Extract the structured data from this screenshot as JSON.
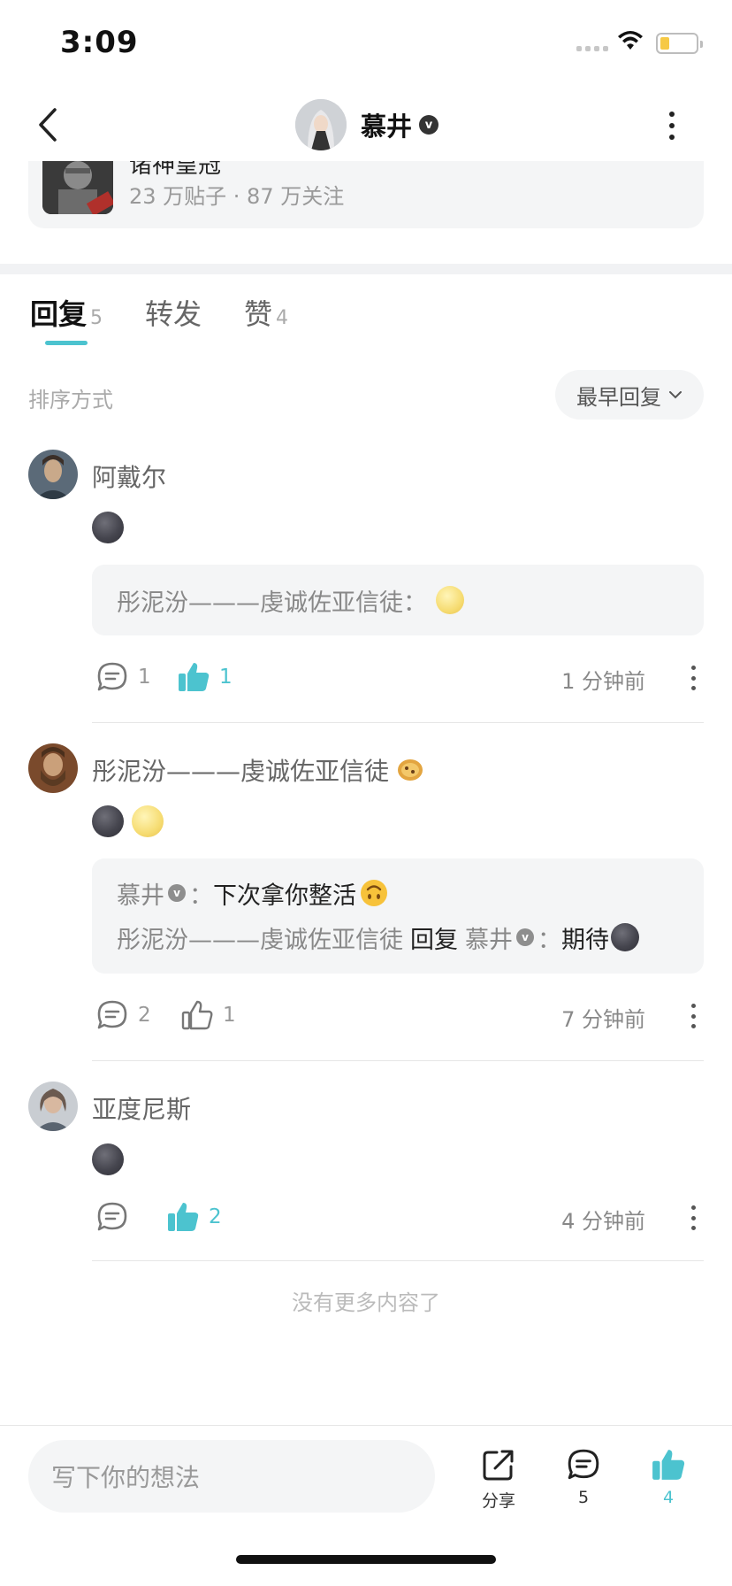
{
  "status_bar": {
    "time": "3:09"
  },
  "nav": {
    "title": "慕井",
    "verified_mark": "v"
  },
  "forum": {
    "name": "诸神皇冠",
    "stats": "23 万贴子 · 87 万关注"
  },
  "tabs": [
    {
      "label": "回复",
      "count": "5",
      "active": true
    },
    {
      "label": "转发",
      "count": "",
      "active": false
    },
    {
      "label": "赞",
      "count": "4",
      "active": false
    }
  ],
  "sort": {
    "label": "排序方式",
    "button": "最早回复"
  },
  "comments": [
    {
      "author": "阿戴尔",
      "body_emojis": [
        "new-moon-face"
      ],
      "quote": {
        "name": "彤泥汾———虔诚佐亚信徒：",
        "emoji": "full-moon-face"
      },
      "reply_count": "1",
      "like_count": "1",
      "liked": true,
      "time": "1 分钟前"
    },
    {
      "author": "彤泥汾———虔诚佐亚信徒",
      "author_badge": "cookie",
      "body_emojis": [
        "new-moon-face",
        "full-moon-face"
      ],
      "quotes": [
        {
          "name": "慕井",
          "sep": "：",
          "text": "下次拿你整活",
          "emoji": "upside-down-face"
        },
        {
          "name": "彤泥汾———虔诚佐亚信徒",
          "reply_word": "回复",
          "target": "慕井",
          "sep": "：",
          "text": "期待",
          "emoji": "new-moon-face"
        }
      ],
      "reply_count": "2",
      "like_count": "1",
      "liked": false,
      "time": "7 分钟前"
    },
    {
      "author": "亚度尼斯",
      "body_emojis": [
        "new-moon-face"
      ],
      "reply_count": "",
      "like_count": "2",
      "liked": true,
      "time": "4 分钟前"
    }
  ],
  "footer": {
    "no_more": "没有更多内容了"
  },
  "bottom_bar": {
    "input_placeholder": "写下你的想法",
    "share_label": "分享",
    "comment_count": "5",
    "like_count": "4"
  },
  "colors": {
    "accent": "#4cc3cf",
    "card_bg": "#f4f5f6",
    "muted": "#999999"
  }
}
